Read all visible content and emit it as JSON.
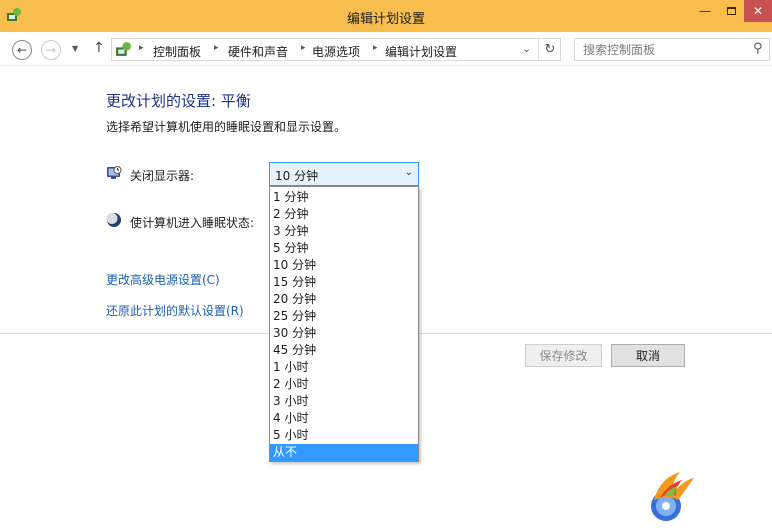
{
  "window": {
    "title": "编辑计划设置",
    "min_glyph": "—",
    "close_glyph": "✕"
  },
  "nav": {
    "back_glyph": "←",
    "forward_glyph": "→",
    "recent_glyph": "▼",
    "up_glyph": "↑",
    "breadcrumb": [
      "控制面板",
      "硬件和声音",
      "电源选项",
      "编辑计划设置"
    ],
    "crumb_sep": "▸",
    "dropdown_glyph": "⌄",
    "refresh_glyph": "↻"
  },
  "search": {
    "placeholder": "搜索控制面板",
    "icon_glyph": "⚲"
  },
  "page": {
    "title": "更改计划的设置: 平衡",
    "description": "选择希望计算机使用的睡眠设置和显示设置。"
  },
  "settings": {
    "display_off_label": "关闭显示器:",
    "display_off_value": "10 分钟",
    "sleep_label": "使计算机进入睡眠状态:"
  },
  "links": {
    "advanced": "更改高级电源设置(C)",
    "restore": "还原此计划的默认设置(R)"
  },
  "buttons": {
    "save": "保存修改",
    "cancel": "取消"
  },
  "dropdown": {
    "arrow_glyph": "⌄",
    "options": [
      "1 分钟",
      "2 分钟",
      "3 分钟",
      "5 分钟",
      "10 分钟",
      "15 分钟",
      "20 分钟",
      "25 分钟",
      "30 分钟",
      "45 分钟",
      "1 小时",
      "2 小时",
      "3 小时",
      "4 小时",
      "5 小时",
      "从不"
    ],
    "highlighted": "从不"
  },
  "colors": {
    "titlebar": "#f7bd4d",
    "accent": "#3399ff",
    "link": "#1c5fb0",
    "title_text": "#1e3287"
  }
}
